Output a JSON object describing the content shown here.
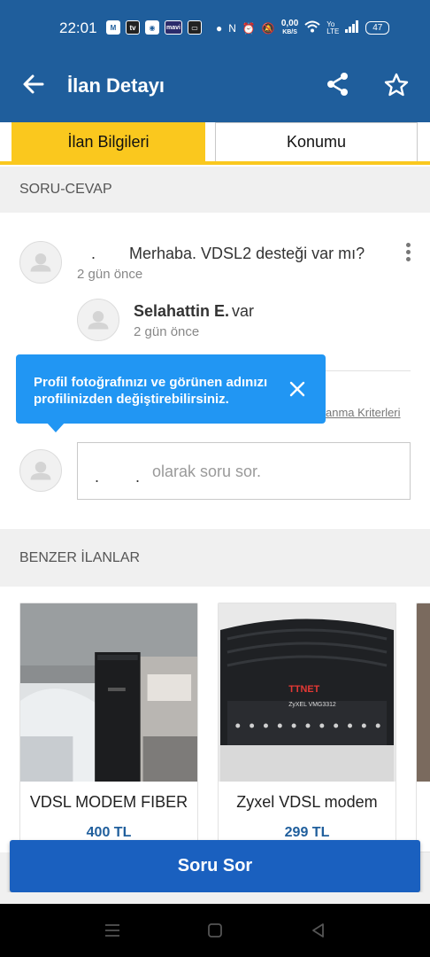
{
  "status_bar": {
    "time": "22:01",
    "app_icons": [
      "mail-icon",
      "tv-icon",
      "app-icon",
      "mavi-icon",
      "app-icon"
    ],
    "speed_value": "0,00",
    "speed_unit": "KB/S",
    "network": "Yo LTE",
    "battery": "47"
  },
  "app_bar": {
    "title": "İlan Detayı"
  },
  "tabs": [
    {
      "label": "İlan Bilgileri",
      "active": true
    },
    {
      "label": "Konumu",
      "active": false
    }
  ],
  "qa": {
    "section_title": "SORU-CEVAP",
    "question": {
      "user": ".",
      "text": "Merhaba. VDSL2 desteği var mı?",
      "time": "2 gün önce"
    },
    "answer": {
      "user": "Selahattin E.",
      "text": "var",
      "time": "2 gün önce"
    },
    "criteria_link": "anma Kriterleri",
    "ask_input": {
      "user": ". .",
      "placeholder": "olarak soru sor."
    }
  },
  "tooltip": {
    "text": "Profil fotoğrafınızı ve görünen adınızı profilinizden değiştirebilirsiniz."
  },
  "similar": {
    "section_title": "BENZER İLANLAR",
    "items": [
      {
        "title": "VDSL MODEM FIBER",
        "price": "400 TL"
      },
      {
        "title": "Zyxel VDSL modem",
        "price": "299 TL"
      }
    ],
    "modem_label_brand": "TTNET",
    "modem_label_model": "ZyXEL VMG3312"
  },
  "ask_button": {
    "label": "Soru Sor"
  },
  "colors": {
    "primary": "#1f5e9c",
    "accent": "#fac81e",
    "button": "#1a60bf",
    "tooltip": "#2196f3"
  }
}
